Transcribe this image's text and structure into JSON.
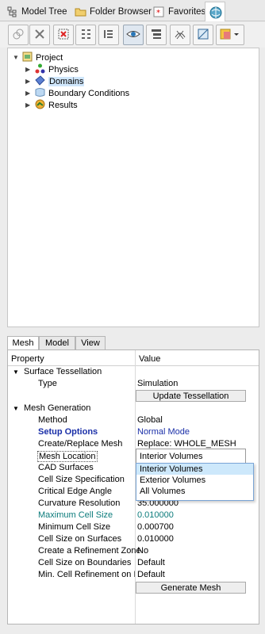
{
  "top_tabs": [
    {
      "label": "Model Tree",
      "icon": "model-tree-icon"
    },
    {
      "label": "Folder Browser",
      "icon": "folder-browser-icon"
    },
    {
      "label": "Favorites",
      "icon": "favorites-icon"
    },
    {
      "label": "",
      "icon": "simulation-globe-icon"
    }
  ],
  "toolbar": {
    "buttons": [
      "link-icon",
      "delete-icon",
      "filter-icon",
      "expand-list-icon",
      "collapse-list-icon",
      "eye-icon",
      "tree-view-icon",
      "mesh-icon",
      "panel-icon",
      "color-icon"
    ]
  },
  "tree": {
    "root": "Project",
    "children": [
      {
        "label": "Physics"
      },
      {
        "label": "Domains",
        "selected": true
      },
      {
        "label": "Boundary Conditions"
      },
      {
        "label": "Results"
      }
    ]
  },
  "bottom_tabs": [
    "Mesh",
    "Model",
    "View"
  ],
  "props": {
    "col_property": "Property",
    "col_value": "Value",
    "surface_tessellation": "Surface Tessellation",
    "type_label": "Type",
    "type_value": "Simulation",
    "update_btn": "Update Tessellation",
    "mesh_generation": "Mesh Generation",
    "method_label": "Method",
    "method_value": "Global",
    "setup_label": "Setup Options",
    "setup_value": "Normal Mode",
    "create_label": "Create/Replace Mesh",
    "create_value": "Replace: WHOLE_MESH",
    "meshloc_label": "Mesh Location",
    "meshloc_value": "Interior Volumes",
    "cad_label": "CAD Surfaces",
    "cellspec_label": "Cell Size Specification",
    "critedge_label": "Critical Edge Angle",
    "curv_label": "Curvature Resolution",
    "curv_value": "35.000000",
    "maxcell_label": "Maximum Cell Size",
    "maxcell_value": "0.010000",
    "mincell_label": "Minimum Cell Size",
    "mincell_value": "0.000700",
    "cellsurf_label": "Cell Size on Surfaces",
    "cellsurf_value": "0.010000",
    "refzone_label": "Create a Refinement Zone",
    "refzone_value": "No",
    "cellbound_label": "Cell Size on Boundaries",
    "cellbound_value": "Default",
    "mincellref_label": "Min. Cell Refinement on Bo",
    "mincellref_value": "Default",
    "generate_btn": "Generate Mesh",
    "dropdown_options": [
      "Interior Volumes",
      "Exterior Volumes",
      "All Volumes"
    ]
  }
}
